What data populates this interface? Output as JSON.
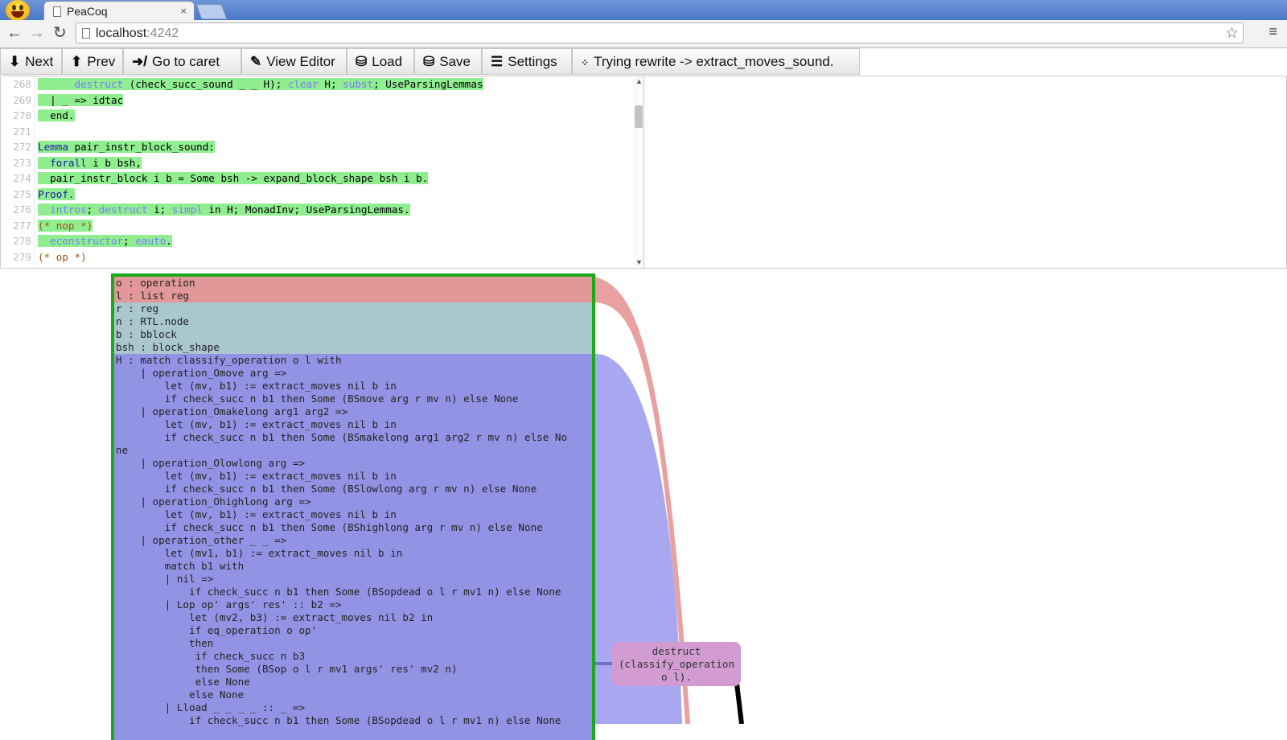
{
  "browser": {
    "tab_title": "PeaCoq",
    "tab_close": "×",
    "url_host": "localhost",
    "url_port": ":4242",
    "star": "☆",
    "menu": "≡",
    "back": "←",
    "forward": "→",
    "reload": "↻"
  },
  "toolbar": {
    "next": "Next",
    "prev": "Prev",
    "go_to_caret": "Go to caret",
    "view_editor": "View Editor",
    "load": "Load",
    "save": "Save",
    "settings": "Settings",
    "status": "Trying rewrite -> extract_moves_sound."
  },
  "editor": {
    "lines": [
      {
        "n": "268",
        "segs": [
          {
            "t": "      ",
            "c": "hl"
          },
          {
            "t": "destruct",
            "c": "hl kw"
          },
          {
            "t": " (check_succ_sound _ _ H); ",
            "c": "hl"
          },
          {
            "t": "clear",
            "c": "hl kw"
          },
          {
            "t": " H; ",
            "c": "hl"
          },
          {
            "t": "subst",
            "c": "hl kw"
          },
          {
            "t": "; UseParsingLemmas",
            "c": "hl"
          }
        ]
      },
      {
        "n": "269",
        "segs": [
          {
            "t": "  | _ => idtac",
            "c": "hl"
          }
        ]
      },
      {
        "n": "270",
        "segs": [
          {
            "t": "  end.",
            "c": "hl"
          }
        ]
      },
      {
        "n": "271",
        "segs": []
      },
      {
        "n": "272",
        "segs": [
          {
            "t": "Lemma",
            "c": "hl kwd"
          },
          {
            "t": " pair_instr_block_sound:",
            "c": "hl"
          }
        ]
      },
      {
        "n": "273",
        "segs": [
          {
            "t": "  forall",
            "c": "hl kwd"
          },
          {
            "t": " i b bsh,",
            "c": "hl"
          }
        ]
      },
      {
        "n": "274",
        "segs": [
          {
            "t": "  pair_instr_block i b = Some bsh -> expand_block_shape bsh i b.",
            "c": "hl"
          }
        ]
      },
      {
        "n": "275",
        "segs": [
          {
            "t": "Proof.",
            "c": "hl kwd"
          }
        ]
      },
      {
        "n": "276",
        "segs": [
          {
            "t": "  ",
            "c": "hl"
          },
          {
            "t": "intros",
            "c": "hl kw"
          },
          {
            "t": "; ",
            "c": "hl"
          },
          {
            "t": "destruct",
            "c": "hl kw"
          },
          {
            "t": " i; ",
            "c": "hl"
          },
          {
            "t": "simpl",
            "c": "hl kw"
          },
          {
            "t": " in H; MonadInv; UseParsingLemmas.",
            "c": "hl"
          }
        ]
      },
      {
        "n": "277",
        "segs": [
          {
            "t": "(* nop *)",
            "c": "hl cm"
          }
        ]
      },
      {
        "n": "278",
        "segs": [
          {
            "t": "  ",
            "c": "hl"
          },
          {
            "t": "econstructor",
            "c": "hl kw"
          },
          {
            "t": "; ",
            "c": "hl"
          },
          {
            "t": "eauto",
            "c": "hl kw"
          },
          {
            "t": ".",
            "c": "hl"
          }
        ]
      },
      {
        "n": "279",
        "segs": [
          {
            "t": "(* op *)",
            "c": "cm"
          }
        ]
      }
    ]
  },
  "proof_tree": {
    "hyp_red": "o : operation\nl : list reg",
    "hyp_gray": "r : reg\nn : RTL.node\nb : bblock\nbsh : block_shape",
    "hyp_blue": "H : match classify_operation o l with\n    | operation_Omove arg =>\n        let (mv, b1) := extract_moves nil b in\n        if check_succ n b1 then Some (BSmove arg r mv n) else None\n    | operation_Omakelong arg1 arg2 =>\n        let (mv, b1) := extract_moves nil b in\n        if check_succ n b1 then Some (BSmakelong arg1 arg2 r mv n) else No\nne\n    | operation_Olowlong arg =>\n        let (mv, b1) := extract_moves nil b in\n        if check_succ n b1 then Some (BSlowlong arg r mv n) else None\n    | operation_Ohighlong arg =>\n        let (mv, b1) := extract_moves nil b in\n        if check_succ n b1 then Some (BShighlong arg r mv n) else None\n    | operation_other _ _ =>\n        let (mv1, b1) := extract_moves nil b in\n        match b1 with\n        | nil =>\n            if check_succ n b1 then Some (BSopdead o l r mv1 n) else None\n        | Lop op' args' res' :: b2 =>\n            let (mv2, b3) := extract_moves nil b2 in\n            if eq_operation o op'\n            then\n             if check_succ n b3\n             then Some (BSop o l r mv1 args' res' mv2 n)\n             else None\n            else None\n        | Lload _ _ _ _ :: _ =>\n            if check_succ n b1 then Some (BSopdead o l r mv1 n) else None",
    "tactic": "destruct\n(classify_operation\no l)."
  },
  "colors": {
    "highlight": "#90ee90",
    "hyp_red": "#e29898",
    "hyp_gray": "#aac6cf",
    "hyp_blue": "#9393e6",
    "tactic": "#d29bd2",
    "tree_border": "#19a919"
  }
}
